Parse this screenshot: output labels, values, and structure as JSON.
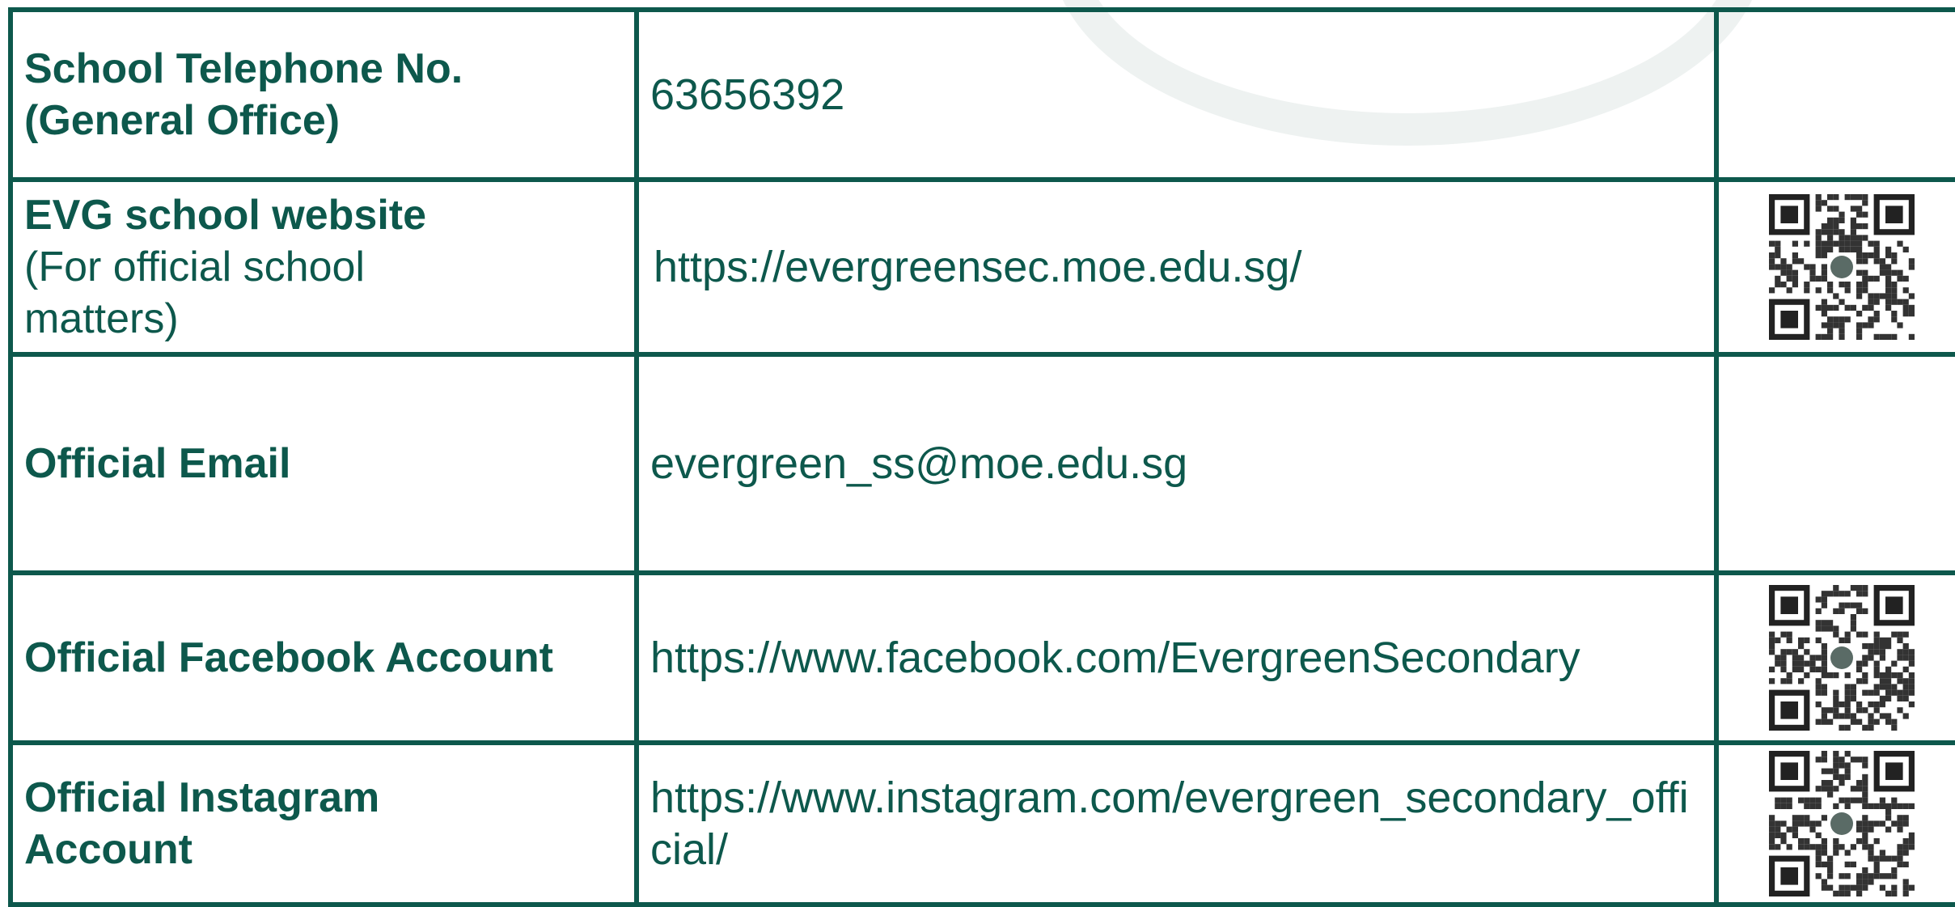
{
  "rows": [
    {
      "label_bold": "School Telephone No. (General Office)",
      "label_normal": "",
      "value": "63656392",
      "has_qr": false
    },
    {
      "label_bold": "EVG school website",
      "label_normal": "(For official school matters)",
      "value": "https://evergreensec.moe.edu.sg/",
      "has_qr": true,
      "qr_icon": "qr-code-icon"
    },
    {
      "label_bold": "Official Email",
      "label_normal": "",
      "value": "evergreen_ss@moe.edu.sg",
      "has_qr": false
    },
    {
      "label_bold": "Official Facebook Account",
      "label_normal": "",
      "value": "https://www.facebook.com/EvergreenSecondary",
      "has_qr": true,
      "qr_icon": "qr-code-icon"
    },
    {
      "label_bold": "Official Instagram Account",
      "label_normal": "",
      "value": "https://www.instagram.com/evergreen_secondary_official/",
      "has_qr": true,
      "qr_icon": "qr-code-icon"
    }
  ],
  "colors": {
    "border": "#0d584c",
    "text": "#0d584c"
  }
}
